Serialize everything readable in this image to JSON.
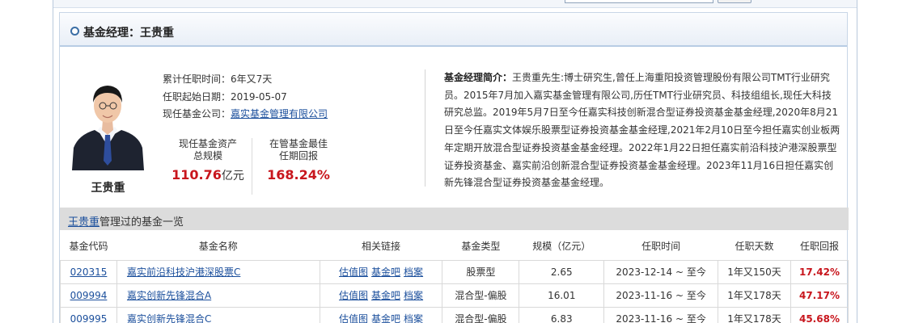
{
  "panel": {
    "title": "基金经理：王贵重"
  },
  "manager": {
    "name": "王贵重",
    "tenure_label": "累计任职时间：",
    "tenure_value": "6年又7天",
    "start_label": "任职起始日期：",
    "start_value": "2019-05-07",
    "company_label": "现任基金公司：",
    "company_value": "嘉实基金管理有限公司",
    "stat_assets_label_1": "现任基金资产",
    "stat_assets_label_2": "总规模",
    "stat_assets_value": "110.76",
    "stat_assets_unit": "亿元",
    "stat_return_label_1": "在管基金最佳",
    "stat_return_label_2": "任期回报",
    "stat_return_value": "168.24%"
  },
  "bio": {
    "label": "基金经理简介：",
    "text": "王贵重先生:博士研究生,曾任上海重阳投资管理股份有限公司TMT行业研究员。2015年7月加入嘉实基金管理有限公司,历任TMT行业研究员、科技组组长,现任大科技研究总监。2019年5月7日至今任嘉实科技创新混合型证券投资基金基金经理,2020年8月21日至今任嘉实文体娱乐股票型证券投资基金基金经理,2021年2月10日至今担任嘉实创业板两年定期开放混合型证券投资基金基金经理。2022年1月22日担任嘉实前沿科技沪港深股票型证券投资基金、嘉实前沿创新混合型证券投资基金基金经理。2023年11月16日担任嘉实创新先锋混合型证券投资基金基金经理。"
  },
  "list": {
    "manager_link": "王贵重",
    "title_suffix": "管理过的基金一览",
    "headers": [
      "基金代码",
      "基金名称",
      "相关链接",
      "基金类型",
      "规模（亿元）",
      "任职时间",
      "任职天数",
      "任职回报"
    ],
    "links": [
      "估值图",
      "基金吧",
      "档案"
    ],
    "rows": [
      {
        "code": "020315",
        "name": "嘉实前沿科技沪港深股票C",
        "type": "股票型",
        "size": "2.65",
        "period": "2023-12-14 ~ 至今",
        "days": "1年又150天",
        "ret": "17.42%"
      },
      {
        "code": "009994",
        "name": "嘉实创新先锋混合A",
        "type": "混合型-偏股",
        "size": "16.01",
        "period": "2023-11-16 ~ 至今",
        "days": "1年又178天",
        "ret": "47.17%"
      },
      {
        "code": "009995",
        "name": "嘉实创新先锋混合C",
        "type": "混合型-偏股",
        "size": "6.83",
        "period": "2023-11-16 ~ 至今",
        "days": "1年又178天",
        "ret": "45.68%"
      }
    ]
  },
  "colors": {
    "accent_blue": "#1b4f9c",
    "return_red": "#c8161d",
    "header_bar": "#dcdcdc"
  }
}
